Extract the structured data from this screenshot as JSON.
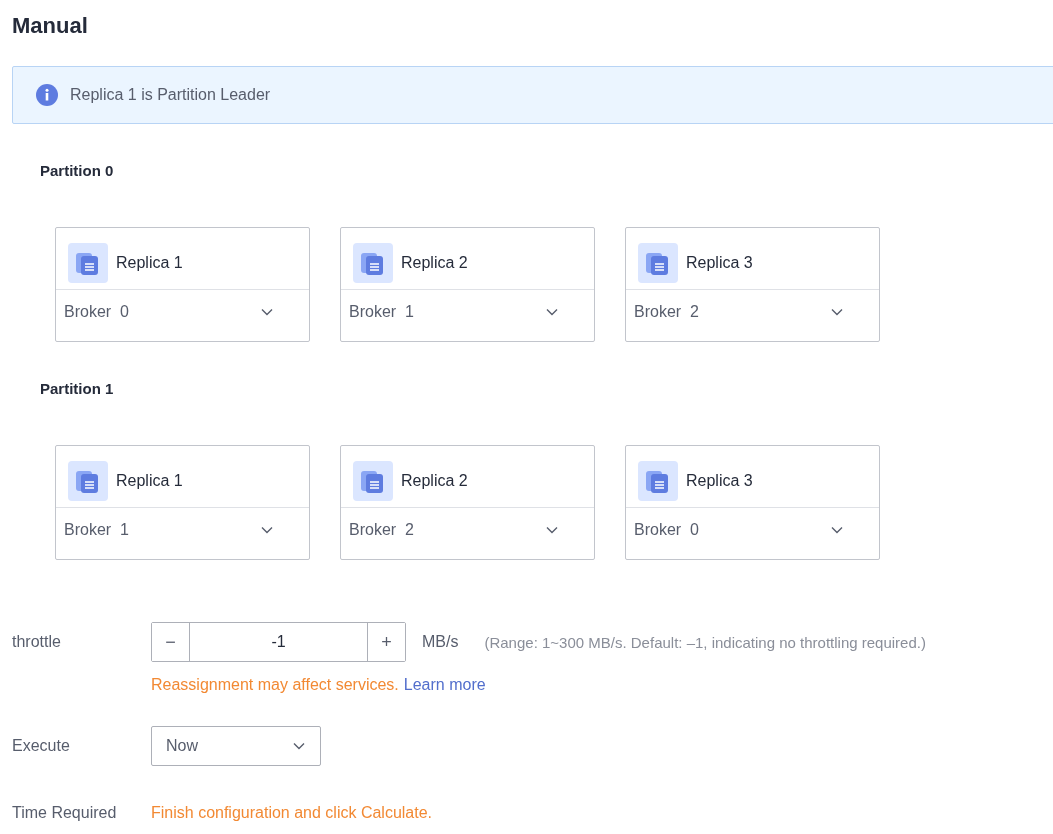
{
  "title": "Manual",
  "info": {
    "text": "Replica 1 is Partition Leader"
  },
  "partitions": [
    {
      "label": "Partition 0",
      "replicas": [
        {
          "name": "Replica 1",
          "broker": "Broker  0"
        },
        {
          "name": "Replica 2",
          "broker": "Broker  1"
        },
        {
          "name": "Replica 3",
          "broker": "Broker  2"
        }
      ]
    },
    {
      "label": "Partition 1",
      "replicas": [
        {
          "name": "Replica 1",
          "broker": "Broker  1"
        },
        {
          "name": "Replica 2",
          "broker": "Broker  2"
        },
        {
          "name": "Replica 3",
          "broker": "Broker  0"
        }
      ]
    }
  ],
  "throttle": {
    "label": "throttle",
    "minus": "−",
    "value": "-1",
    "plus": "+",
    "unit": "MB/s",
    "hint": "(Range: 1~300 MB/s. Default: –1, indicating no throttling required.)",
    "warning": "Reassignment may affect services.",
    "link": "Learn more"
  },
  "execute": {
    "label": "Execute",
    "value": "Now"
  },
  "time_required": {
    "label": "Time Required",
    "value": "Finish configuration and click Calculate."
  }
}
